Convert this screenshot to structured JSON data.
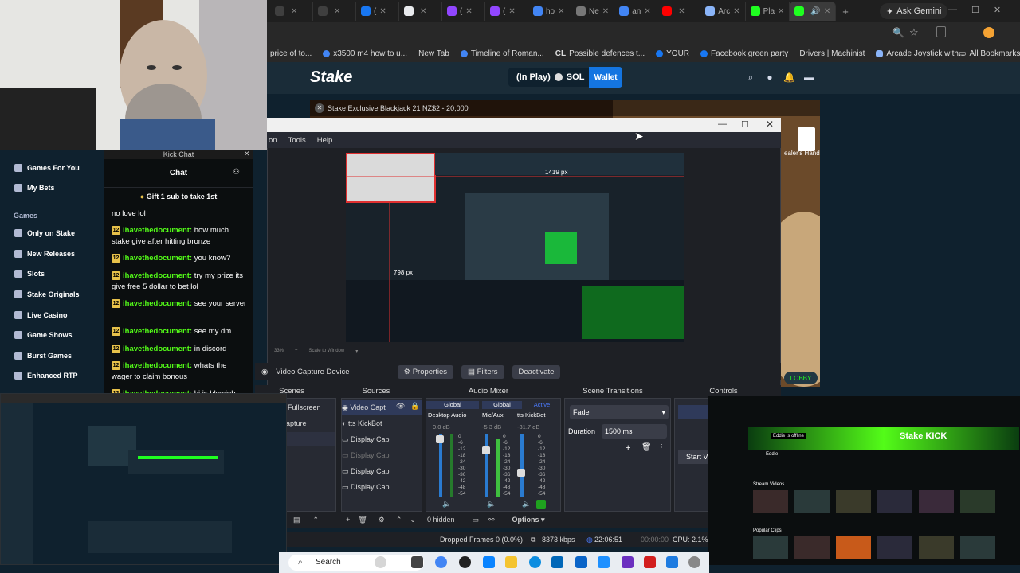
{
  "browser": {
    "tabs": [
      {
        "label": "",
        "color": "#3f3f3f"
      },
      {
        "label": "",
        "color": "#3f3f3f"
      },
      {
        "label": "(",
        "color": "#1877f2"
      },
      {
        "label": "",
        "color": "#e8eaed"
      },
      {
        "label": "(",
        "color": "#9146ff"
      },
      {
        "label": "(",
        "color": "#9146ff"
      },
      {
        "label": "ho",
        "color": "#4285f4"
      },
      {
        "label": "Ne",
        "color": "#777777"
      },
      {
        "label": "an",
        "color": "#4285f4"
      },
      {
        "label": "",
        "color": "#ff0000"
      },
      {
        "label": "Arc",
        "color": "#8ab4f8"
      },
      {
        "label": "Pla",
        "color": "#1fff20"
      },
      {
        "label": "",
        "color": "#1fff20"
      }
    ],
    "ask_gemini": "Ask Gemini",
    "bookmarks": [
      {
        "label": "price of to...",
        "color": "#555555"
      },
      {
        "label": "x3500 m4 how to u...",
        "color": "#4285f4"
      },
      {
        "label": "New Tab",
        "color": "#777777"
      },
      {
        "label": "Timeline of Roman...",
        "color": "#4285f4"
      },
      {
        "label": "Possible defences t...",
        "color": "#ffffff"
      },
      {
        "label": "YOUR",
        "color": "#1877f2"
      },
      {
        "label": "Facebook green party",
        "color": "#1877f2"
      },
      {
        "label": "Drivers | Machinist",
        "color": "#555555"
      },
      {
        "label": "Arcade Joystick with...",
        "color": "#8ab4f8"
      }
    ],
    "all_bookmarks": "All Bookmarks"
  },
  "stake": {
    "logo": "Stake",
    "balance_label": "(In Play)",
    "currency": "SOL",
    "wallet": "Wallet",
    "game_banner": "Stake Exclusive Blackjack 21 NZ$2 - 20,000",
    "dealer_hand": "ealer's Hand",
    "lobby": "LOBBY",
    "sidebar": {
      "items_top": [
        "Games For You",
        "My Bets"
      ],
      "games_heading": "Games",
      "items": [
        "Only on Stake",
        "New Releases",
        "Slots",
        "Stake Originals",
        "Live Casino",
        "Game Shows",
        "Burst Games",
        "Enhanced RTP"
      ]
    }
  },
  "kick_chat": {
    "window_title": "Kick Chat",
    "header": "Chat",
    "gift": "Gift 1 sub to take 1st",
    "messages": [
      {
        "user": "",
        "text": "no love lol",
        "badge": ""
      },
      {
        "user": "ihavethedocument:",
        "text": " how much stake give after hitting bronze",
        "badge": "12"
      },
      {
        "user": "ihavethedocument:",
        "text": " you know?",
        "badge": "12"
      },
      {
        "user": "ihavethedocument:",
        "text": " try my prize its give free 5 dollar to bet lol",
        "badge": "12"
      },
      {
        "user": "ihavethedocument:",
        "text": " see your server",
        "badge": "12"
      },
      {
        "user": "ihavethedocument:",
        "text": " see my dm",
        "badge": "12"
      },
      {
        "user": "ihavethedocument:",
        "text": " in discord",
        "badge": "12"
      },
      {
        "user": "ihavethedocument:",
        "text": " whats the wager to claim bonous",
        "badge": "12"
      },
      {
        "user": "ihavethedocument:",
        "text": " hi is blowjob",
        "badge": "12"
      }
    ]
  },
  "obs": {
    "menu": [
      "on",
      "Tools",
      "Help"
    ],
    "preview_width_label": "1419 px",
    "preview_height_label": "798 px",
    "zoom_label": "33%",
    "scale_label": "Scale to Window",
    "source_toolbar": {
      "source": "Video Capture Device",
      "properties": "Properties",
      "filters": "Filters",
      "deactivate": "Deactivate"
    },
    "docks": {
      "scenes": "Scenes",
      "sources": "Sources",
      "audio_mixer": "Audio Mixer",
      "scene_transitions": "Scene Transitions",
      "controls": "Controls"
    },
    "scenes": [
      "Fullscreen",
      "apture"
    ],
    "sources": [
      "Video Capt",
      "tts KickBot",
      "Display Cap",
      "Display Cap",
      "Display Cap",
      "Display Cap"
    ],
    "mixer": {
      "headers": [
        "Global",
        "Global",
        "Active"
      ],
      "channels": [
        {
          "name": "Desktop Audio",
          "db": "0.0 dB"
        },
        {
          "name": "Mic/Aux",
          "db": "-5.3 dB"
        },
        {
          "name": "tts KickBot",
          "db": "-31.7 dB"
        }
      ],
      "scale": [
        "0",
        "-6",
        "-12",
        "-18",
        "-24",
        "-30",
        "-36",
        "-42",
        "-48",
        "-54",
        "-60"
      ],
      "hidden": "0 hidden",
      "options": "Options"
    },
    "transitions": {
      "type": "Fade",
      "duration_label": "Duration",
      "duration_value": "1500 ms"
    },
    "controls": {
      "start": "Start V"
    },
    "status": {
      "dropped": "Dropped Frames 0 (0.0%)",
      "bitrate": "8373 kbps",
      "time": "22:06:51",
      "rec": "00:00:00",
      "cpu": "CPU: 2.1%"
    }
  },
  "thumb_right": {
    "offline": "Eddie is offline",
    "channel": "Eddie",
    "banner": "Stake KICK",
    "section_videos": "Stream Videos",
    "section_clips": "Popular Clips"
  },
  "taskbar": {
    "search": "Search"
  }
}
